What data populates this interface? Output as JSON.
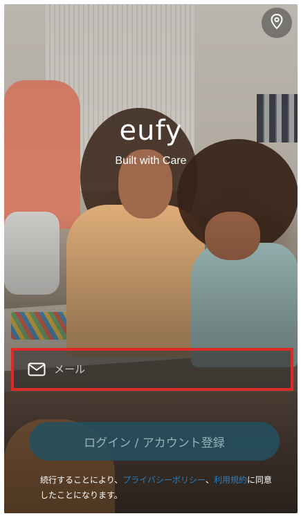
{
  "brand": {
    "logo_text": "eufy",
    "tagline": "Built with Care"
  },
  "header": {
    "location_icon": "map-pin-icon"
  },
  "login_form": {
    "email_icon": "mail-icon",
    "email_placeholder": "メール",
    "email_value": "",
    "highlight_color": "#e02a25",
    "login_button_label": "ログイン / アカウント登録"
  },
  "terms": {
    "prefix": "続行することにより、",
    "privacy_link": "プライバシーポリシー",
    "separator": "、",
    "terms_link": "利用規約",
    "suffix": "に同意したことになります。",
    "link_color": "#2a7fc0"
  }
}
